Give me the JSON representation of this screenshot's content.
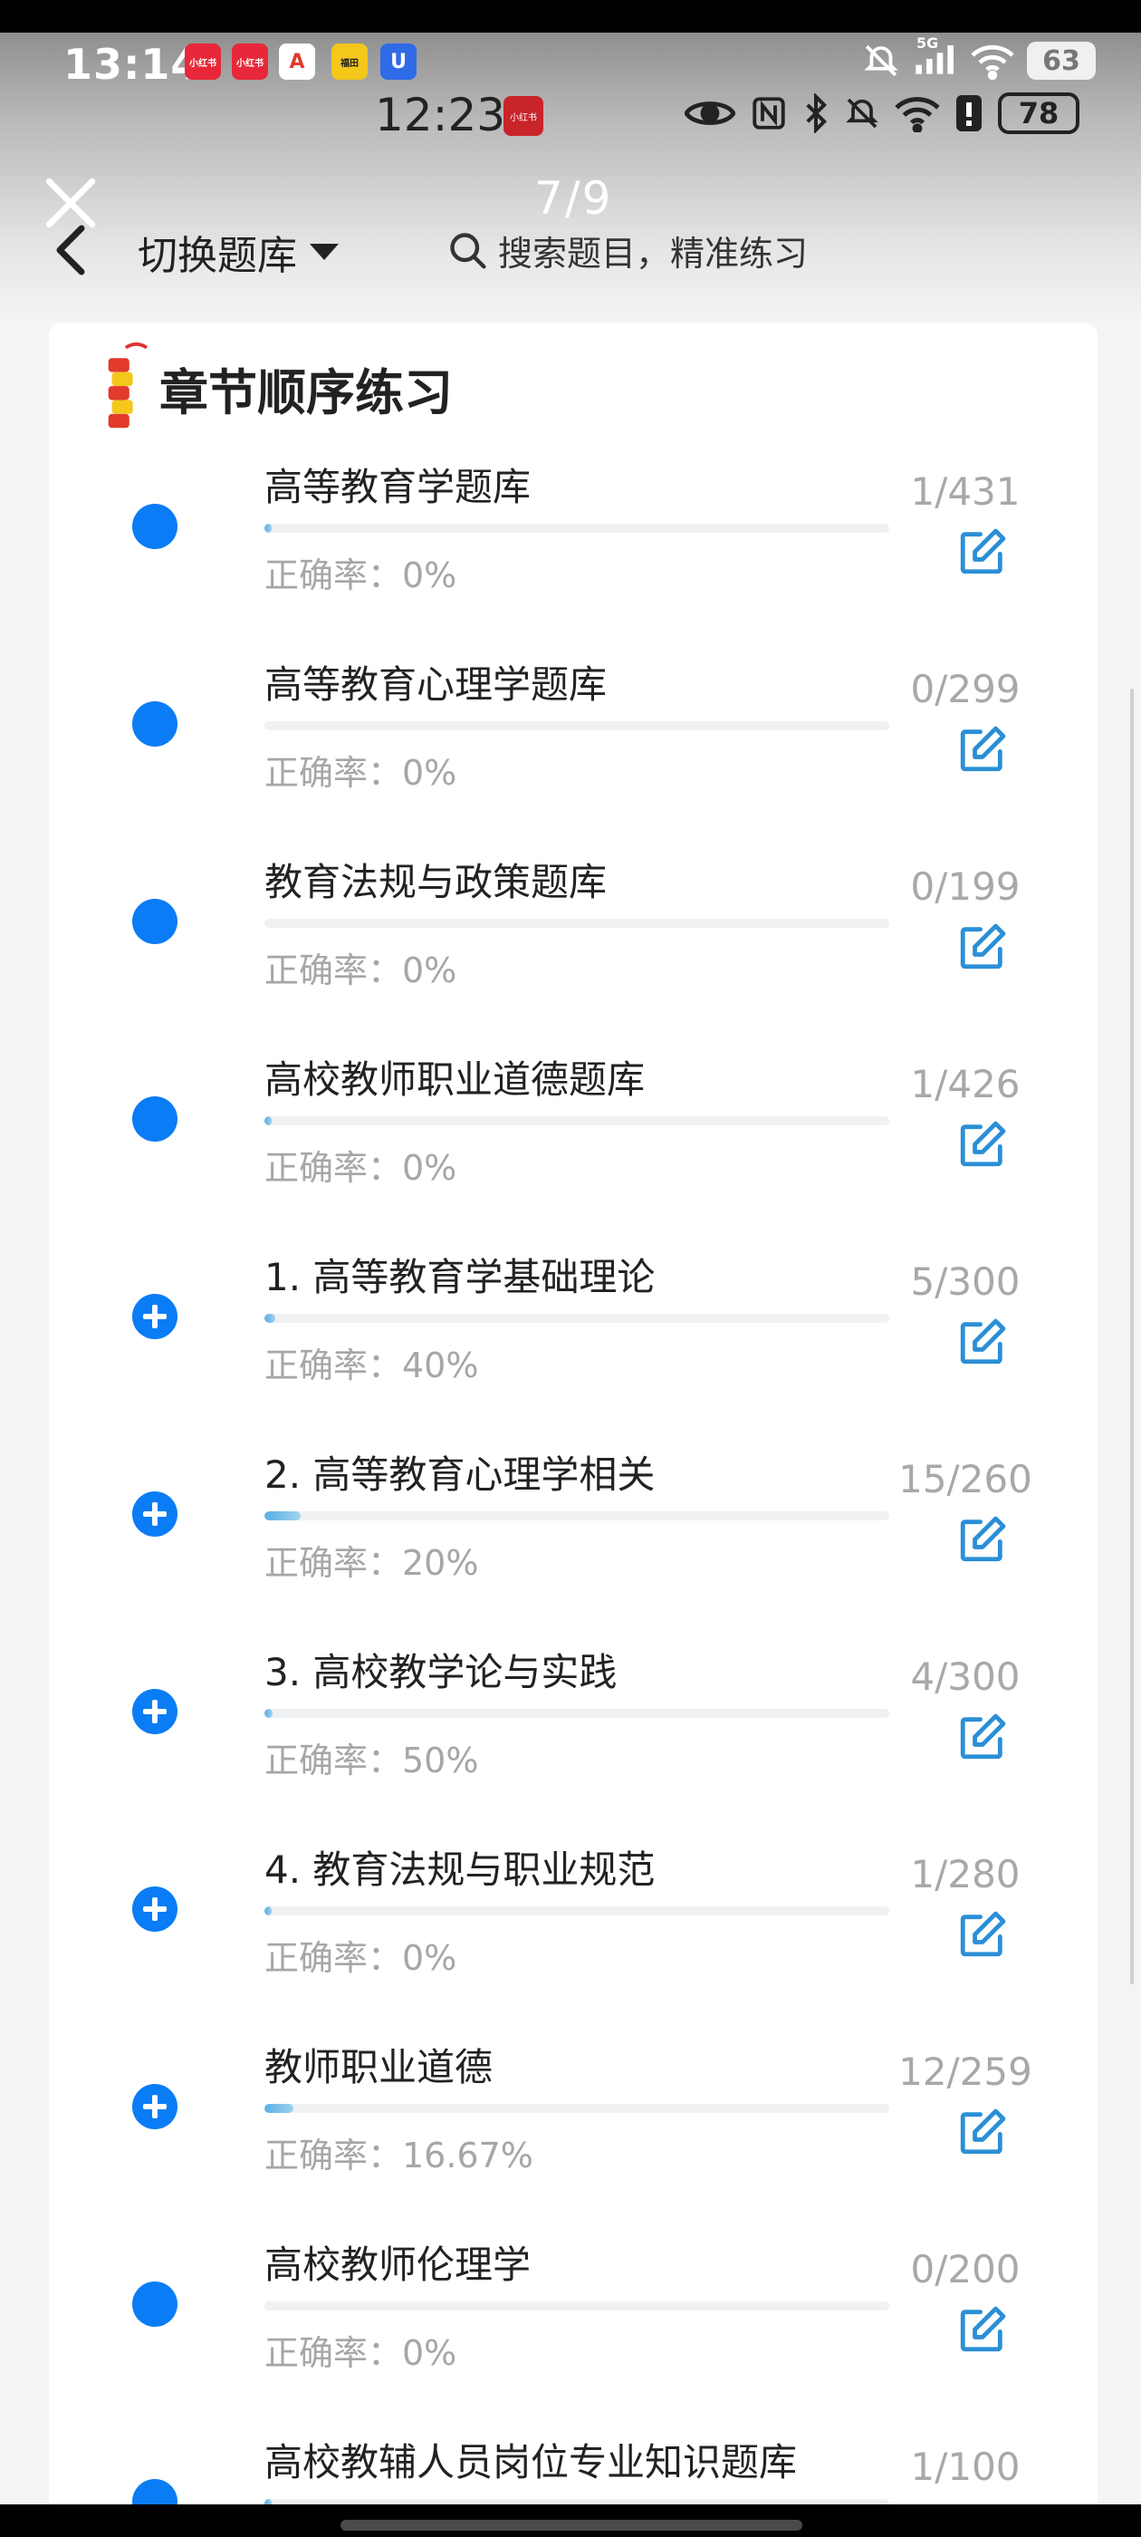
{
  "status_bar_outer": {
    "time": "13:14",
    "apps": [
      {
        "name": "xiaohongshu-icon",
        "label": "小红书",
        "color": "#e8283a"
      },
      {
        "name": "xiaohongshu-icon-2",
        "label": "小红书",
        "color": "#e8283a"
      },
      {
        "name": "app-a-icon",
        "label": "A",
        "color": "#e23a2c"
      },
      {
        "name": "yellow-app-icon",
        "label": "福田",
        "color": "#f4c71b"
      },
      {
        "name": "shield-app-icon",
        "label": "U",
        "color": "#2f6be6"
      }
    ],
    "battery": "63",
    "network": "5G"
  },
  "status_bar_inner": {
    "time": "12:23",
    "battery": "78"
  },
  "nav": {
    "page_indicator": "7/9",
    "switch_label": "切换题库",
    "search_placeholder": "搜索题目，精准练习"
  },
  "section": {
    "title": "章节顺序练习"
  },
  "items": [
    {
      "title": "高等教育学题库",
      "accuracy": "正确率：0%",
      "count": "1/431",
      "progress": 0.0023,
      "icon": "dot"
    },
    {
      "title": "高等教育心理学题库",
      "accuracy": "正确率：0%",
      "count": "0/299",
      "progress": 0,
      "icon": "dot"
    },
    {
      "title": "教育法规与政策题库",
      "accuracy": "正确率：0%",
      "count": "0/199",
      "progress": 0,
      "icon": "dot"
    },
    {
      "title": "高校教师职业道德题库",
      "accuracy": "正确率：0%",
      "count": "1/426",
      "progress": 0.0023,
      "icon": "dot"
    },
    {
      "title": "1. 高等教育学基础理论",
      "accuracy": "正确率：40%",
      "count": "5/300",
      "progress": 0.0167,
      "icon": "plus"
    },
    {
      "title": "2. 高等教育心理学相关",
      "accuracy": "正确率：20%",
      "count": "15/260",
      "progress": 0.0577,
      "icon": "plus"
    },
    {
      "title": "3. 高校教学论与实践",
      "accuracy": "正确率：50%",
      "count": "4/300",
      "progress": 0.0133,
      "icon": "plus"
    },
    {
      "title": "4. 教育法规与职业规范",
      "accuracy": "正确率：0%",
      "count": "1/280",
      "progress": 0.0036,
      "icon": "plus"
    },
    {
      "title": "教师职业道德",
      "accuracy": "正确率：16.67%",
      "count": "12/259",
      "progress": 0.0463,
      "icon": "plus"
    },
    {
      "title": "高校教师伦理学",
      "accuracy": "正确率：0%",
      "count": "0/200",
      "progress": 0,
      "icon": "dot"
    },
    {
      "title": "高校教辅人员岗位专业知识题库",
      "accuracy": "",
      "count": "1/100",
      "progress": 0.01,
      "icon": "dot"
    }
  ],
  "colors": {
    "accent": "#0a7cf5",
    "edit_icon": "#2b8fd6",
    "muted_text": "#a6a6a6"
  }
}
